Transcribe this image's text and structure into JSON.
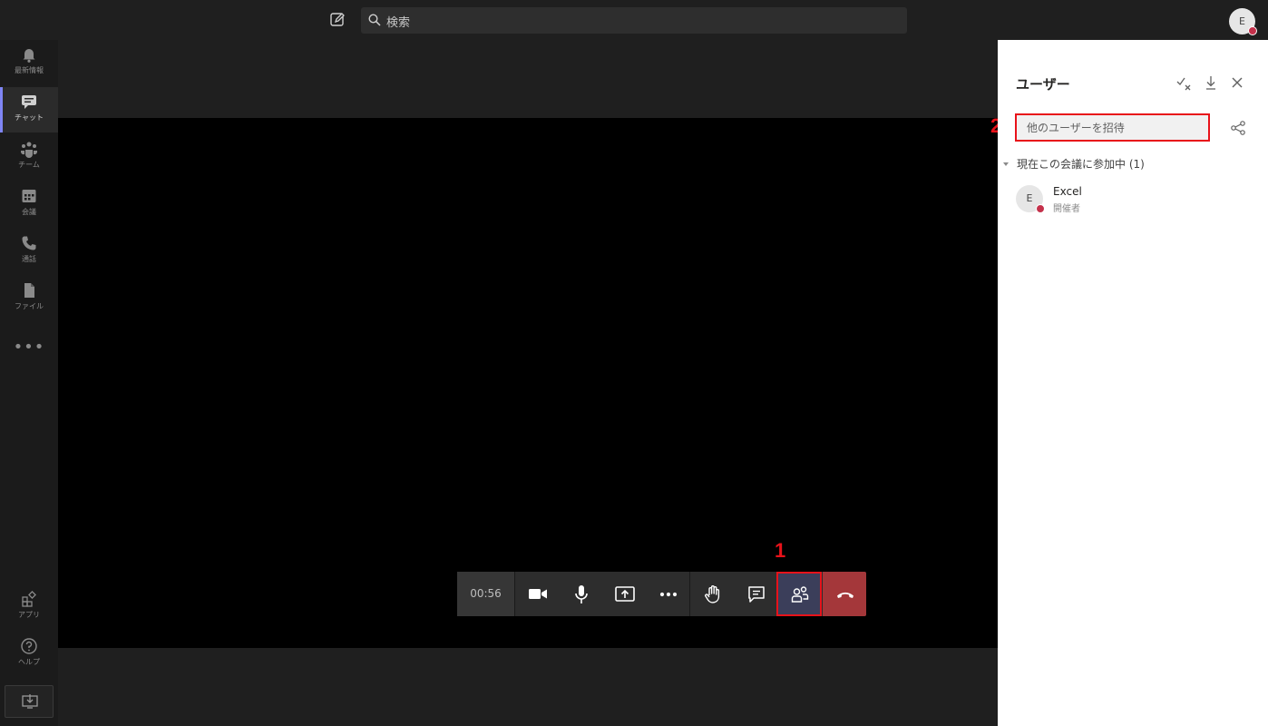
{
  "topbar": {
    "search_placeholder": "検索",
    "avatar_initial": "E"
  },
  "rail": {
    "items": [
      {
        "label": "最新情報",
        "icon": "bell-icon"
      },
      {
        "label": "チャット",
        "icon": "chat-icon",
        "active": true
      },
      {
        "label": "チーム",
        "icon": "teams-icon"
      },
      {
        "label": "会議",
        "icon": "calendar-icon"
      },
      {
        "label": "通話",
        "icon": "phone-icon"
      },
      {
        "label": "ファイル",
        "icon": "file-icon"
      }
    ],
    "more": "•••",
    "apps_label": "アプリ",
    "help_label": "ヘルプ"
  },
  "call": {
    "timer": "00:56",
    "controls": [
      "camera-icon",
      "mic-icon",
      "share-screen-icon",
      "more-icon",
      "raise-hand-icon",
      "chat-icon",
      "participants-icon",
      "hangup-icon"
    ]
  },
  "annotations": {
    "step1": "1",
    "step2": "2",
    "highlight_color": "#e8121a"
  },
  "panel": {
    "title": "ユーザー",
    "invite_placeholder": "他のユーザーを招待",
    "section_label": "現在この会議に参加中 (1)",
    "participants": [
      {
        "initial": "E",
        "name": "Excel",
        "role": "開催者"
      }
    ]
  },
  "colors": {
    "accent": "#7f85f5",
    "hangup": "#a4373a",
    "presence_busy": "#c4314b"
  }
}
